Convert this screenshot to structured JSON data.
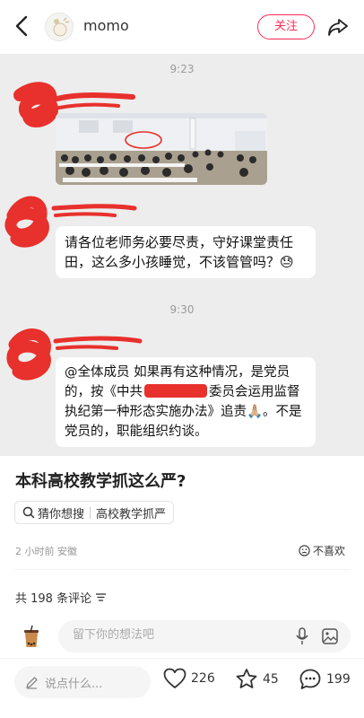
{
  "header": {
    "author_name": "momo",
    "follow_label": "关注"
  },
  "chat": {
    "time_1": "9:23",
    "message_1": "请各位老师务必要尽责，守好课堂责任田，这么多小孩睡觉，不该管管吗？😓",
    "time_2": "9:30",
    "message_2_part1": "@全体成员 如果再有这种情况，是党员的，按《中共",
    "message_2_part2": "委员会运用监督执纪第一种形态实施办法》追责🙏🏼。不是党员的，职能组织约谈。",
    "redact_color": "#e8302c"
  },
  "post": {
    "title": "本科高校教学抓这么严?",
    "search_prefix": "猜你想搜",
    "search_term": "高校教学抓严",
    "time_location": "2 小时前 安徽",
    "dislike_label": "不喜欢",
    "comment_count": "共 198 条评论"
  },
  "comment_box": {
    "placeholder": "留下你的想法吧"
  },
  "bottom_bar": {
    "say_placeholder": "说点什么...",
    "likes": "226",
    "stars": "45",
    "comments": "199"
  },
  "colors": {
    "accent": "#ff2d55",
    "background": "#ffffff",
    "chat_background": "#ededed"
  }
}
